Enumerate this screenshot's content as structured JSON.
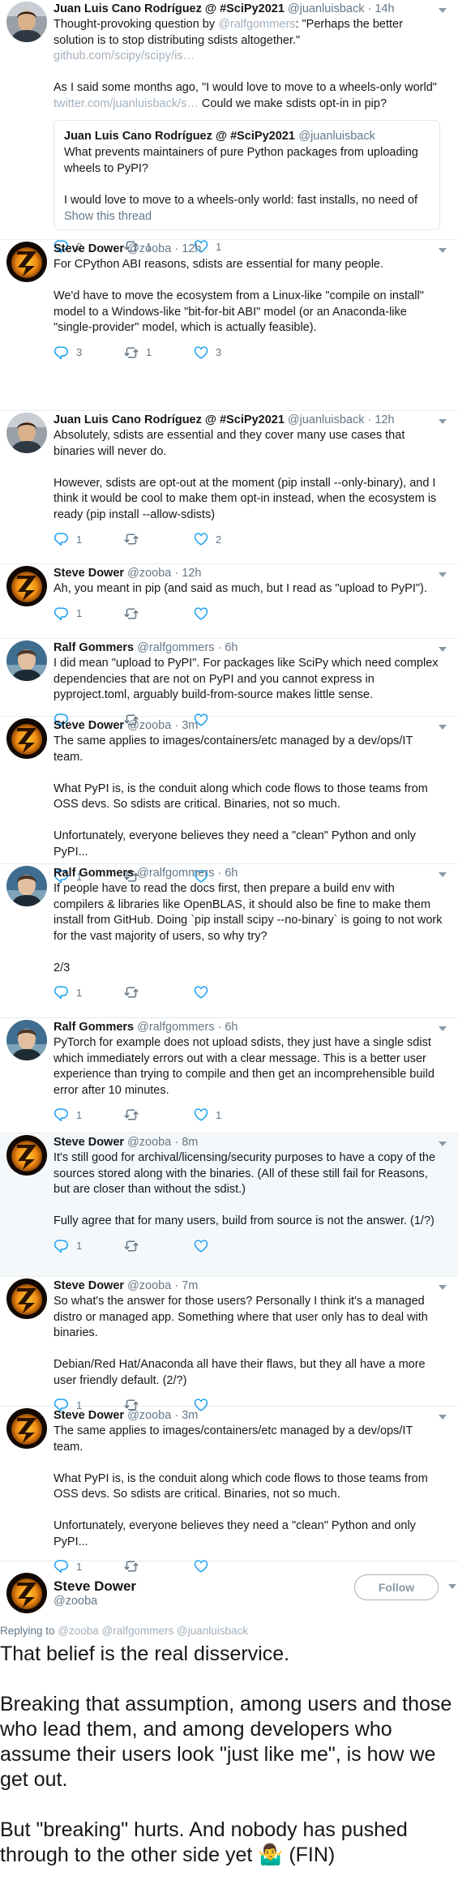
{
  "tweets": [
    {
      "name": "Juan Luis Cano Rodríguez @ #SciPy2021",
      "handle": "@juanluisback",
      "time": "14h",
      "p1_before": "Thought-provoking question by ",
      "p1_mention": "@ralfgommers",
      "p1_mid": ": \"Perhaps the better solution is to stop distributing sdists altogether.\" ",
      "p1_link": "github.com/scipy/scipy/is…",
      "p2_before": "As I said some months ago, \"I would love to move to a wheels-only world\" ",
      "p2_link": "twitter.com/juanluisback/s…",
      "p2_after": " Could we make sdists opt-in in pip?",
      "quote": {
        "name": "Juan Luis Cano Rodríguez @ #SciPy2021",
        "handle": "@juanluisback",
        "p1": "What prevents maintainers of pure Python packages from uploading wheels to PyPI?",
        "p2": "I would love to move to a wheels-only world: fast installs, no need of",
        "show": "Show this thread"
      },
      "replies": "2",
      "retweets": "1",
      "likes": "1"
    },
    {
      "name": "Steve Dower",
      "handle": "@zooba",
      "time": "12h",
      "paragraphs": [
        "For CPython ABI reasons, sdists are essential for many people.",
        "We'd have to move the ecosystem from a Linux-like \"compile on install\" model to a Windows-like \"bit-for-bit ABI\" model (or an Anaconda-like \"single-provider\" model, which is actually feasible)."
      ],
      "replies": "3",
      "retweets": "1",
      "likes": "3"
    },
    {
      "name": "Juan Luis Cano Rodríguez @ #SciPy2021",
      "handle": "@juanluisback",
      "time": "12h",
      "paragraphs": [
        "Absolutely, sdists are essential and they cover many use cases that binaries will never do.",
        "However, sdists are opt-out at the moment (pip install --only-binary), and I think it would be cool to make them opt-in instead, when the ecosystem is ready (pip install --allow-sdists)"
      ],
      "replies": "1",
      "retweets": "",
      "likes": "2"
    },
    {
      "name": "Steve Dower",
      "handle": "@zooba",
      "time": "12h",
      "paragraphs": [
        "Ah, you meant in pip (and said as much, but I read as \"upload to PyPI\")."
      ],
      "replies": "1",
      "retweets": "",
      "likes": ""
    },
    {
      "name": "Ralf Gommers",
      "handle": "@ralfgommers",
      "time": "6h",
      "paragraphs": [
        "I did mean \"upload to PyPI\". For packages like SciPy which need complex dependencies that are not on PyPI and you cannot express in pyproject.toml, arguably build-from-source makes little sense."
      ],
      "replies": "",
      "retweets": "",
      "likes": ""
    },
    {
      "name": "Steve Dower",
      "handle": "@zooba",
      "time": "3m",
      "paragraphs": [
        "The same applies to images/containers/etc managed by a dev/ops/IT team.",
        "What PyPI is, is the conduit along which code flows to those teams from OSS devs. So sdists are critical. Binaries, not so much.",
        "Unfortunately, everyone believes they need a \"clean\" Python and only PyPI..."
      ],
      "replies": "1",
      "retweets": "",
      "likes": ""
    },
    {
      "name": "Ralf Gommers",
      "handle": "@ralfgommers",
      "time": "6h",
      "paragraphs": [
        "If people have to read the docs first, then prepare a build env with compilers & libraries like OpenBLAS, it should also be fine to make them install from GitHub. Doing `pip install scipy --no-binary` is going to not work for the vast majority of users, so why try?",
        "2/3"
      ],
      "replies": "1",
      "retweets": "",
      "likes": ""
    },
    {
      "name": "Ralf Gommers",
      "handle": "@ralfgommers",
      "time": "6h",
      "paragraphs": [
        "PyTorch for example does not upload sdists, they just have a single sdist which immediately errors out with a clear message. This is a better user experience than trying to compile and then get an incomprehensible build error after 10 minutes."
      ],
      "replies": "1",
      "retweets": "",
      "likes": "1"
    },
    {
      "name": "Steve Dower",
      "handle": "@zooba",
      "time": "8m",
      "paragraphs": [
        "It's still good for archival/licensing/security purposes to have a copy of the sources stored along with the binaries. (All of these still fail for Reasons, but are closer than without the sdist.)",
        "Fully agree that for many users, build from source is not the answer. (1/?)"
      ],
      "replies": "1",
      "retweets": "",
      "likes": ""
    },
    {
      "name": "Steve Dower",
      "handle": "@zooba",
      "time": "7m",
      "paragraphs": [
        "So what's the answer for those users? Personally I think it's a managed distro or managed app. Something where that user only has to deal with binaries.",
        "Debian/Red Hat/Anaconda all have their flaws, but they all have a more user friendly default. (2/?)"
      ],
      "replies": "1",
      "retweets": "",
      "likes": ""
    },
    {
      "name": "Steve Dower",
      "handle": "@zooba",
      "time": "3m",
      "paragraphs": [
        "The same applies to images/containers/etc managed by a dev/ops/IT team.",
        "What PyPI is, is the conduit along which code flows to those teams from OSS devs. So sdists are critical. Binaries, not so much.",
        "Unfortunately, everyone believes they need a \"clean\" Python and only PyPI..."
      ],
      "replies": "1",
      "retweets": "",
      "likes": ""
    }
  ],
  "focused": {
    "name": "Steve Dower",
    "handle": "@zooba",
    "follow_label": "Follow",
    "replying_label": "Replying to",
    "replying_mentions": "@zooba @ralfgommers @juanluisback",
    "paragraphs": [
      "That belief is the real disservice.",
      "Breaking that assumption, among users and those who lead them, and among developers who assume their users look \"just like me\", is how we get out.",
      "But \"breaking\" hurts. And nobody has pushed through to the other side yet 🤷‍♂️ (FIN)"
    ]
  },
  "colors": {
    "text": "#14171a",
    "secondary": "#657786",
    "faded_link": "#a3b1bd",
    "highlight_bg": "#f5f8fa"
  },
  "icons": [
    "reply-icon",
    "retweet-icon",
    "like-icon",
    "caret-down-icon"
  ]
}
